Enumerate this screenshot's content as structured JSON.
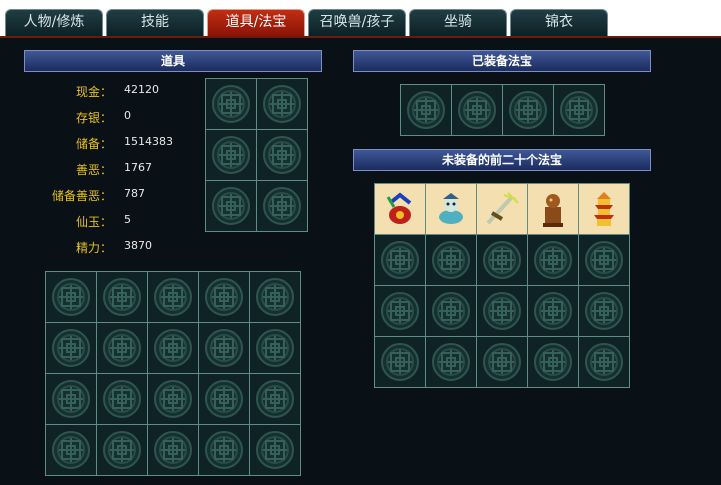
{
  "tabs": [
    {
      "label": "人物/修炼",
      "active": false
    },
    {
      "label": "技能",
      "active": false
    },
    {
      "label": "道具/法宝",
      "active": true
    },
    {
      "label": "召唤兽/孩子",
      "active": false
    },
    {
      "label": "坐骑",
      "active": false
    },
    {
      "label": "锦衣",
      "active": false
    }
  ],
  "items_section": {
    "title": "道具",
    "stats": [
      {
        "label": "现金：",
        "value": "42120"
      },
      {
        "label": "存银：",
        "value": "0"
      },
      {
        "label": "储备：",
        "value": "1514383"
      },
      {
        "label": "善恶：",
        "value": "1767"
      },
      {
        "label": "储备善恶：",
        "value": "787"
      },
      {
        "label": "仙玉：",
        "value": "5"
      },
      {
        "label": "精力：",
        "value": "3870"
      }
    ]
  },
  "equipped_section": {
    "title": "已装备法宝"
  },
  "unequipped_section": {
    "title": "未装备的前二十个法宝",
    "items": [
      "fabao-fan-icon",
      "fabao-spirit-icon",
      "fabao-sword-icon",
      "fabao-seal-icon",
      "fabao-pagoda-icon"
    ]
  },
  "colors": {
    "accent_tab": "#c22d14",
    "label_gold": "#e8c020",
    "panel_bg": "#091116"
  }
}
